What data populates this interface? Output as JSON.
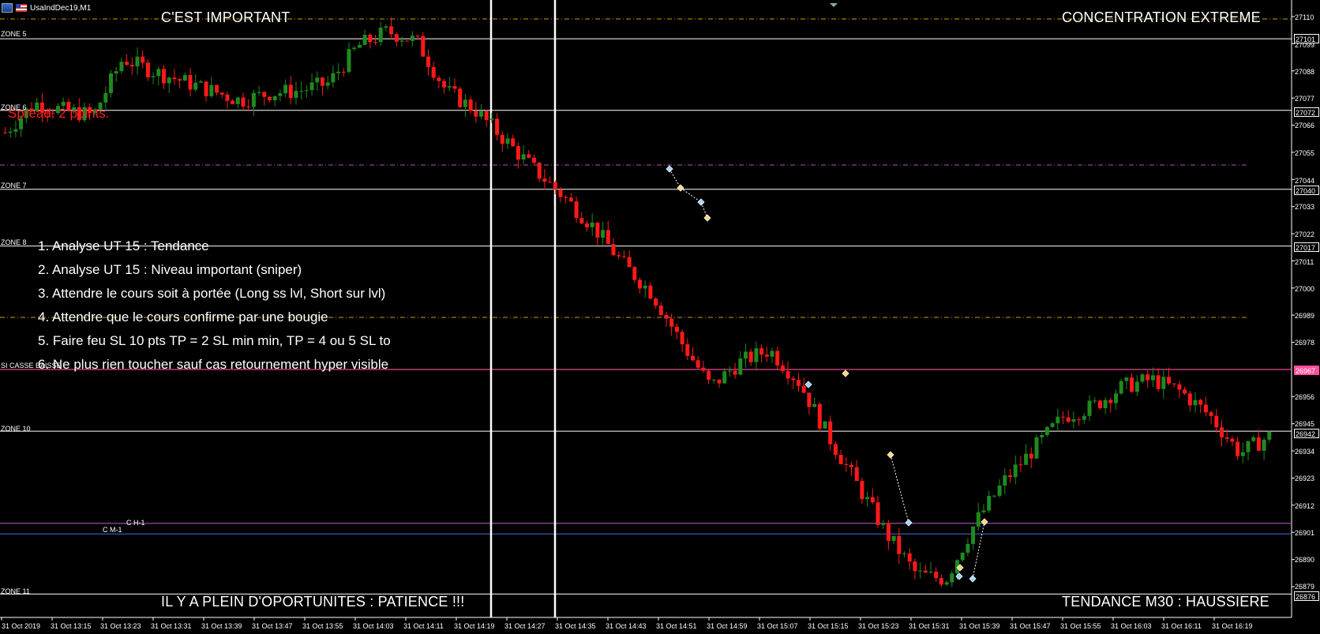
{
  "window": {
    "symbol_title": "UsaIndDec19,M1"
  },
  "labels": {
    "top_left": "C'EST IMPORTANT",
    "top_right": "CONCENTRATION EXTREME",
    "bottom_left": "IL Y A PLEIN D'OPORTUNITES : PATIENCE !!!",
    "bottom_right": "TENDANCE M30 : HAUSSIERE",
    "spread": "Spread: 2 points.",
    "ch1": "C H-1",
    "cm1": "C M-1"
  },
  "steps": [
    "1. Analyse UT 15 : Tendance",
    "2. Analyse UT 15 : Niveau important (sniper)",
    "3. Attendre le cours soit à portée (Long ss lvl, Short sur lvl)",
    "4. Attendre que le cours confirme par une bougie",
    "5. Faire feu SL 10 pts TP = 2 SL min min, TP = 4 ou 5 SL to",
    "6. Ne plus rien toucher sauf cas retournement hyper visible"
  ],
  "zones": [
    {
      "name": "ZONE 5",
      "price": "27101"
    },
    {
      "name": "ZONE 6",
      "price": "27072"
    },
    {
      "name": "ZONE 7",
      "price": "27040"
    },
    {
      "name": "ZONE 8",
      "price": "27017"
    },
    {
      "name": "SI CASSE BAISSE",
      "price": "26967"
    },
    {
      "name": "ZONE 10",
      "price": "26942"
    },
    {
      "name": "ZONE 11",
      "price": "26876"
    }
  ],
  "price_axis": [
    "27110",
    "27099",
    "27088",
    "27077",
    "27066",
    "27055",
    "27044",
    "27033",
    "27022",
    "27011",
    "27000",
    "26989",
    "26978",
    "26956",
    "26945",
    "26934",
    "26923",
    "26912",
    "26901",
    "26890",
    "26879"
  ],
  "time_axis": [
    "31 Oct 2019",
    "31 Oct 13:15",
    "31 Oct 13:23",
    "31 Oct 13:31",
    "31 Oct 13:39",
    "31 Oct 13:47",
    "31 Oct 13:55",
    "31 Oct 14:03",
    "31 Oct 14:11",
    "31 Oct 14:19",
    "31 Oct 14:27",
    "31 Oct 14:35",
    "31 Oct 14:43",
    "31 Oct 14:51",
    "31 Oct 14:59",
    "31 Oct 15:07",
    "31 Oct 15:15",
    "31 Oct 15:23",
    "31 Oct 15:31",
    "31 Oct 15:39",
    "31 Oct 15:47",
    "31 Oct 15:55",
    "31 Oct 16:03",
    "31 Oct 16:11",
    "31 Oct 16:19"
  ],
  "colors": {
    "background": "#000000",
    "bull": "#1f8a1f",
    "bear": "#ff1a1a",
    "zone_line": "#ffffff",
    "dash_orange": "#c8a000",
    "dash_purple": "#b050c0",
    "casse_line": "#ff4fa0",
    "ch1_line": "#c060d0",
    "cm1_line": "#4070e0"
  },
  "chart_data": {
    "type": "candlestick",
    "x": [
      "31 Oct 2019",
      "31 Oct 13:15",
      "31 Oct 13:23",
      "31 Oct 13:31",
      "31 Oct 13:39",
      "31 Oct 13:47",
      "31 Oct 13:55",
      "31 Oct 14:03",
      "31 Oct 14:11",
      "31 Oct 14:19",
      "31 Oct 14:27",
      "31 Oct 14:35",
      "31 Oct 14:43",
      "31 Oct 14:51",
      "31 Oct 14:59",
      "31 Oct 15:07",
      "31 Oct 15:15",
      "31 Oct 15:23",
      "31 Oct 15:31",
      "31 Oct 15:39",
      "31 Oct 15:47",
      "31 Oct 15:55",
      "31 Oct 16:03",
      "31 Oct 16:11",
      "31 Oct 16:19"
    ],
    "close_path": [
      27063,
      27075,
      27072,
      27070,
      27093,
      27088,
      27084,
      27080,
      27076,
      27079,
      27080,
      27083,
      27098,
      27104,
      27100,
      27080,
      27072,
      27060,
      27048,
      27037,
      27025,
      27010,
      26998,
      26978,
      26960,
      26970,
      26975,
      26962,
      26940,
      26920,
      26900,
      26884,
      26882,
      26905,
      26922,
      26935,
      26948,
      26952,
      26960,
      26963,
      26958,
      26948,
      26933,
      26940
    ],
    "levels": {
      "zone5": 27101,
      "zone6": 27072,
      "zone7": 27040,
      "zone8": 27017,
      "casse": 26967,
      "zone10": 26942,
      "zone11": 26876,
      "ch1": 26904,
      "cm1": 26901
    },
    "ylim": [
      26870,
      27115
    ]
  }
}
